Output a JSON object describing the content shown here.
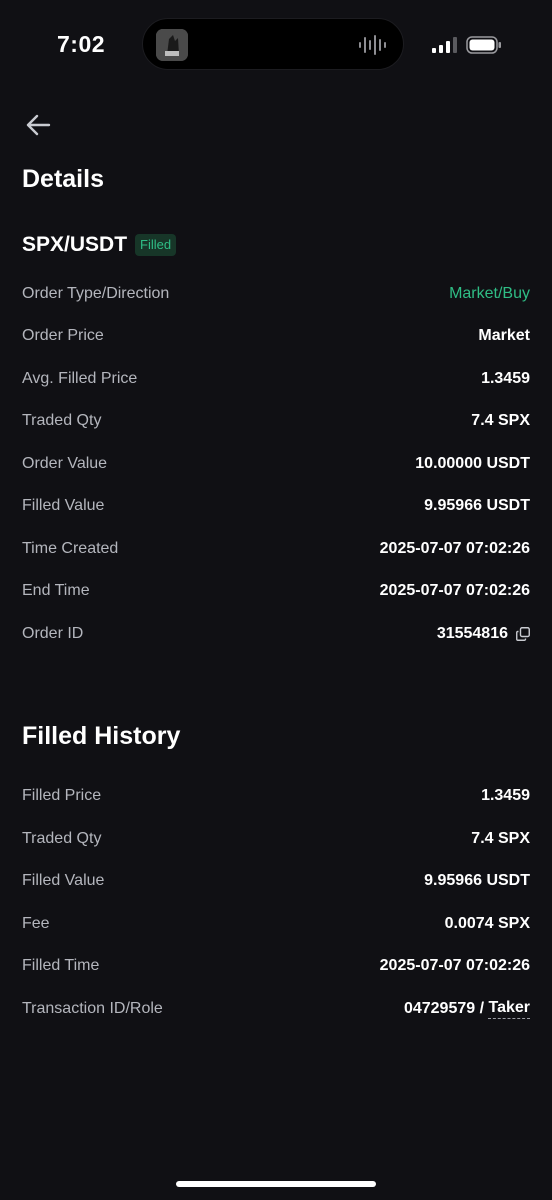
{
  "status_bar": {
    "time": "7:02"
  },
  "header": {
    "title": "Details"
  },
  "order": {
    "pair": "SPX/USDT",
    "status": "Filled",
    "rows": [
      {
        "label": "Order Type/Direction",
        "value": "Market/Buy"
      },
      {
        "label": "Order Price",
        "value": "Market"
      },
      {
        "label": "Avg. Filled Price",
        "value": "1.3459"
      },
      {
        "label": "Traded Qty",
        "value": "7.4 SPX"
      },
      {
        "label": "Order Value",
        "value": "10.00000 USDT"
      },
      {
        "label": "Filled Value",
        "value": "9.95966 USDT"
      },
      {
        "label": "Time Created",
        "value": "2025-07-07 07:02:26"
      },
      {
        "label": "End Time",
        "value": "2025-07-07 07:02:26"
      },
      {
        "label": "Order ID",
        "value": "31554816"
      }
    ]
  },
  "filled_history": {
    "title": "Filled History",
    "rows": [
      {
        "label": "Filled Price",
        "value": "1.3459"
      },
      {
        "label": "Traded Qty",
        "value": "7.4 SPX"
      },
      {
        "label": "Filled Value",
        "value": "9.95966 USDT"
      },
      {
        "label": "Fee",
        "value": "0.0074 SPX"
      },
      {
        "label": "Filled Time",
        "value": "2025-07-07 07:02:26"
      },
      {
        "label": "Transaction ID/Role",
        "value": "04729579 / ",
        "role": "Taker"
      }
    ]
  },
  "icons": {
    "back": "arrow-left-icon",
    "copy": "copy-icon",
    "signal": "cellular-signal-icon",
    "battery": "battery-icon"
  },
  "colors": {
    "background": "#101014",
    "accent_green": "#2fbd85",
    "label_gray": "#b4b6bd"
  }
}
